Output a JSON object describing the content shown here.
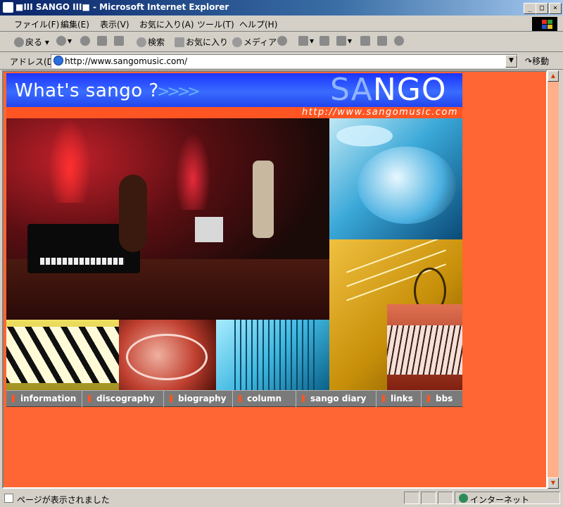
{
  "window": {
    "title": "■III  SANGO  III■ - Microsoft Internet Explorer",
    "min_label": "_",
    "max_label": "□",
    "close_label": "×"
  },
  "menu": [
    "ファイル(F)",
    "編集(E)",
    "表示(V)",
    "お気に入り(A)",
    "ツール(T)",
    "ヘルプ(H)"
  ],
  "toolbar": {
    "back": "戻る",
    "search": "検索",
    "favorites": "お気に入り",
    "media": "メディア"
  },
  "address": {
    "label": "アドレス(D)",
    "url": "http://www.sangomusic.com/",
    "go": "移動"
  },
  "page": {
    "tagline": "What's sango ?",
    "arrows": ">>>>",
    "logo_a": "SA",
    "logo_b": "NGO",
    "site_url": "http://www.sangomusic.com",
    "nav": [
      "information",
      "discography",
      "biography",
      "column",
      "sango diary",
      "links",
      "bbs"
    ]
  },
  "status": {
    "text": "ページが表示されました",
    "zone": "インターネット"
  },
  "colors": {
    "page_bg": "#ff6633",
    "banner_blue": "#2244ee",
    "nav_gray": "#7a7a7a"
  }
}
